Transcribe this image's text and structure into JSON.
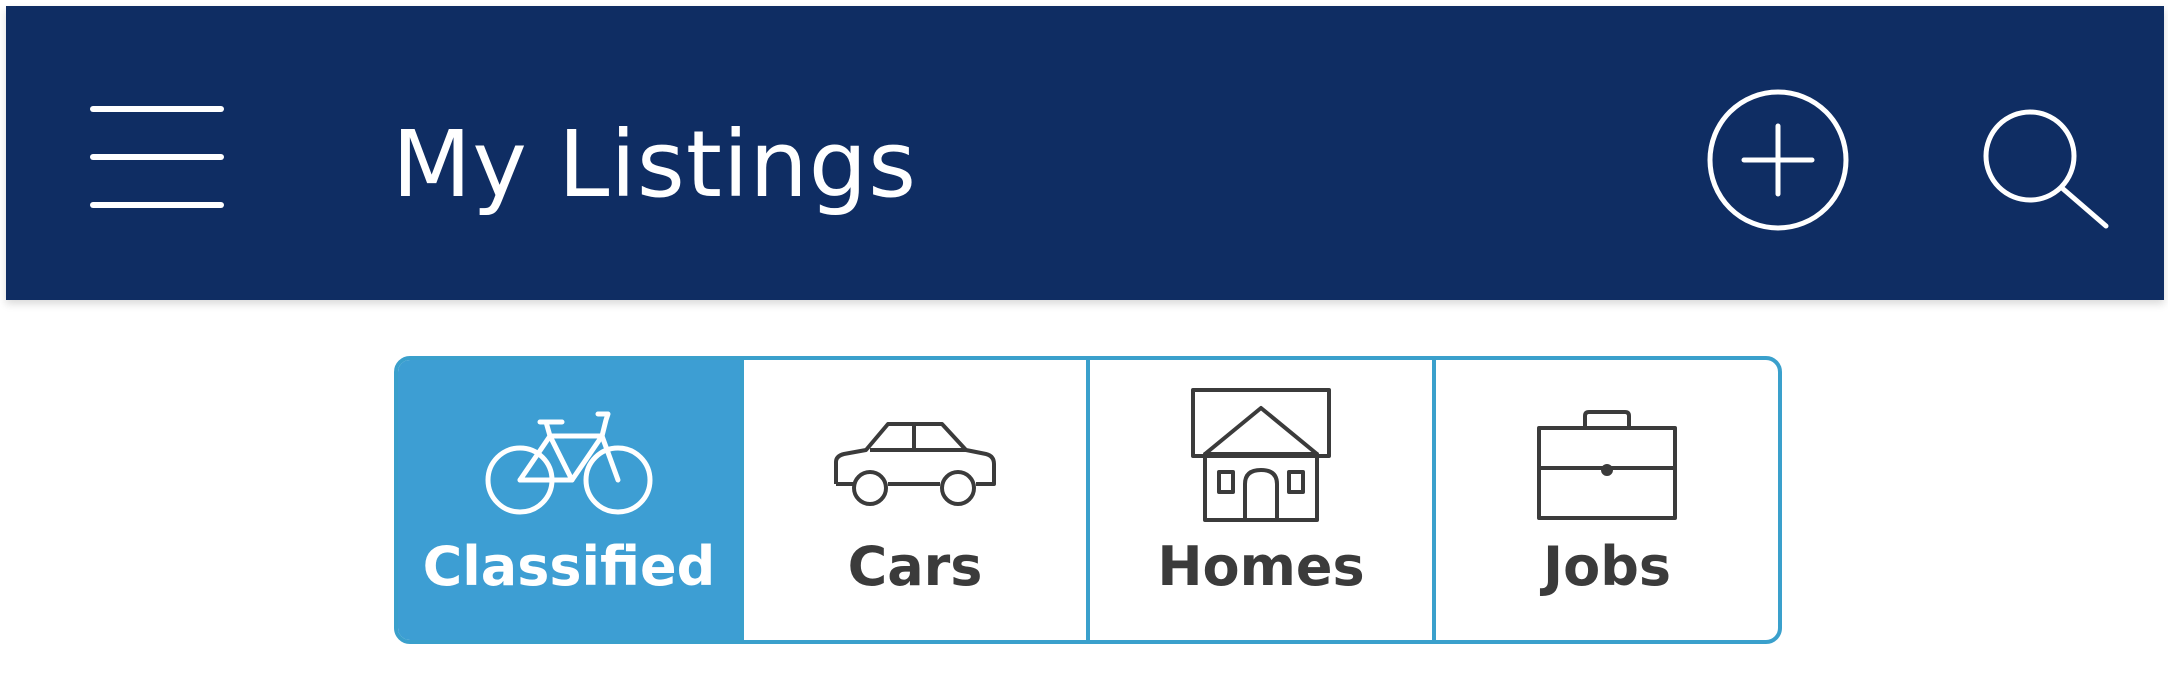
{
  "header": {
    "title": "My Listings",
    "background_color": "#0f2d63",
    "menu_icon": "hamburger-menu-icon",
    "add_icon": "plus-circle-icon",
    "search_icon": "magnifier-icon"
  },
  "category_tabs": {
    "accent_color": "#3d9ed3",
    "border_color": "#3aa0cc",
    "selected": "Classified",
    "items": [
      {
        "label": "Classified",
        "icon": "bicycle-icon",
        "active": true
      },
      {
        "label": "Cars",
        "icon": "car-icon",
        "active": false
      },
      {
        "label": "Homes",
        "icon": "house-icon",
        "active": false
      },
      {
        "label": "Jobs",
        "icon": "briefcase-icon",
        "active": false
      }
    ]
  }
}
